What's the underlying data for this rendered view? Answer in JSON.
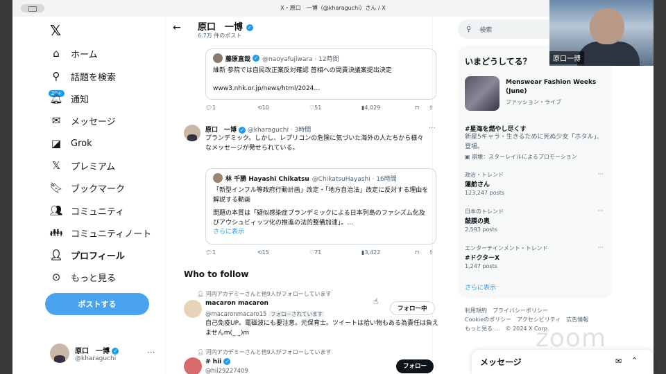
{
  "window": {
    "title": "X・原口　一博（@kharaguchi）さん / X"
  },
  "nav": {
    "items": [
      {
        "label": "ホーム",
        "icon": "home-icon"
      },
      {
        "label": "話題を検索",
        "icon": "search-icon"
      },
      {
        "label": "通知",
        "icon": "bell-icon"
      },
      {
        "label": "メッセージ",
        "icon": "mail-icon"
      },
      {
        "label": "Grok",
        "icon": "grok-icon"
      },
      {
        "label": "プレミアム",
        "icon": "x-icon"
      },
      {
        "label": "ブックマーク",
        "icon": "bookmark-icon"
      },
      {
        "label": "コミュニティ",
        "icon": "community-icon"
      },
      {
        "label": "コミュニティノート",
        "icon": "notes-icon"
      },
      {
        "label": "プロフィール",
        "icon": "profile-icon"
      },
      {
        "label": "もっと見る",
        "icon": "more-icon"
      }
    ],
    "badge": "20+",
    "post_button": "ポストする",
    "me": {
      "name": "原口　一博",
      "handle": "@kharaguchi",
      "dots": "···"
    }
  },
  "header": {
    "back": "←",
    "name": "原口　一博",
    "count": "6.7万 件のポスト"
  },
  "tweet1": {
    "quote": {
      "name": "藤原直哉",
      "handle": "@naoyafujiwara · 12時間",
      "text": "維新 参院では自民改正案反対確認 首相への問責決議案提出決定",
      "link": "www3.nhk.or.jp/news/html/2024…"
    },
    "actions": {
      "replies": "1",
      "retweets": "10",
      "likes": "51",
      "views": "4,029"
    }
  },
  "tweet2": {
    "name": "原口　一博",
    "handle": "@kharaguchi · 3時間",
    "text": "プランデミック。しかし、レプリコンの危険に気づいた海外の人たちから様々なメッセージが発せられている。",
    "quote": {
      "name": "林 千勝 Hayashi Chikatsu",
      "handle": "@ChikatsuHayashi · 16時間",
      "line1": "「新型インフル等政府行動計画」改定・「地方自治法」改定に反対する理由を解説する動画",
      "line2": "問題の本質は「疑似感染症プランデミックによる日本列島のファシズム化及びアウシュビィッツ化の推進の法的整備加速」。…",
      "more": "さらに表示"
    },
    "actions": {
      "replies": "1",
      "retweets": "15",
      "likes": "71",
      "views": "3,422"
    }
  },
  "who_to_follow": {
    "title": "Who to follow",
    "accounts": [
      {
        "context": "河内アカデミーさんと他9人がフォローしています",
        "name": "macaron macaron",
        "handle": "@macaronmacaro15",
        "follows_you": "フォローされています",
        "bio": "自己免疫UP。電磁波にも要注意。元保育士。ツイートは拾い物もある為責任は負えませんm(_ _)m",
        "button": "フォロー中"
      },
      {
        "context": "河内アカデミーさんと他9人がフォローしています",
        "name": "# hii",
        "handle": "@hii29227409",
        "button": "フォロー"
      }
    ]
  },
  "search": {
    "placeholder": "検索"
  },
  "trends": {
    "title": "いまどうしてる？",
    "event": {
      "name": "Menswear Fashion Weeks (June)",
      "sub": "ファッション・ライブ"
    },
    "promo": {
      "title": "#星海を燃やし尽くす",
      "desc": "新星5キャラ・生きるために死ぬ少女「ホタル」、登場。",
      "by": "崩壊：スターレイルによるプロモーション"
    },
    "items": [
      {
        "cat": "政治・トレンド",
        "name": "蓮舫さん",
        "posts": "123,247 posts"
      },
      {
        "cat": "日本のトレンド",
        "name": "鼓膜の奥",
        "posts": "2,593 posts"
      },
      {
        "cat": "エンターテインメント・トレンド",
        "name": "#ドクターX",
        "posts": "1,247 posts"
      }
    ],
    "show_more": "さらに表示"
  },
  "footer": {
    "line1": "利用規約　プライバシーポリシー",
    "line2": "Cookieのポリシー　アクセシビリティ　広告情報",
    "line3": "もっと見る …　© 2024 X Corp."
  },
  "messages": {
    "title": "メッセージ"
  },
  "video": {
    "name": "原口一博"
  },
  "zoom": {
    "watermark": "zoom"
  },
  "colors": {
    "accent": "#1d9bf0",
    "post_button": "#4aa3ee",
    "text": "#0f1419",
    "muted": "#536471"
  }
}
